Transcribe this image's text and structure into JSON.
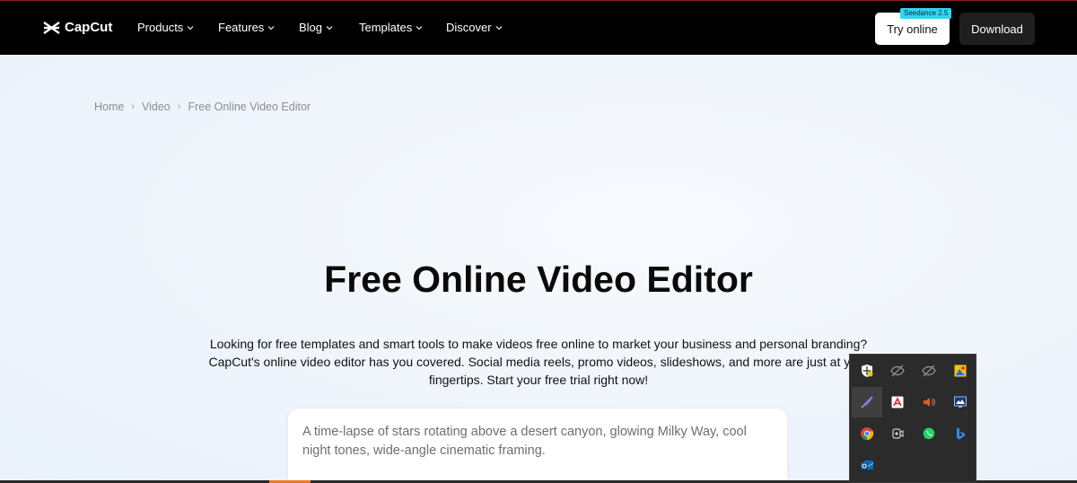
{
  "nav": {
    "logo_text": "CapCut",
    "items": [
      {
        "label": "Products"
      },
      {
        "label": "Features"
      },
      {
        "label": "Blog"
      },
      {
        "label": "Templates"
      },
      {
        "label": "Discover"
      }
    ],
    "try_online_label": "Try online",
    "badge_label": "Seedance 2.5",
    "download_label": "Download"
  },
  "breadcrumb": {
    "items": [
      "Home",
      "Video",
      "Free Online Video Editor"
    ]
  },
  "hero": {
    "title": "Free Online Video Editor",
    "description": "Looking for free templates and smart tools to make videos free online to market your business and personal branding? CapCut's online video editor has you covered. Social media reels, promo videos, slideshows, and more are just at your fingertips. Start your free trial right now!",
    "prompt_text": "A time-lapse of stars rotating above a desert canyon, glowing Milky Way, cool night tones, wide-angle cinematic framing."
  },
  "tray": {
    "icons": [
      "windows-security-icon",
      "hidden-eye-icon",
      "hidden-eye-icon",
      "image-app-icon",
      "feather-pen-icon",
      "adobe-acrobat-icon",
      "volume-icon",
      "monitor-app-icon",
      "chrome-icon",
      "meet-now-icon",
      "whatsapp-icon",
      "bing-icon",
      "outlook-icon"
    ]
  },
  "colors": {
    "nav_bg": "#000000",
    "badge": "#33d5ef",
    "accent": "#e87a2c"
  }
}
